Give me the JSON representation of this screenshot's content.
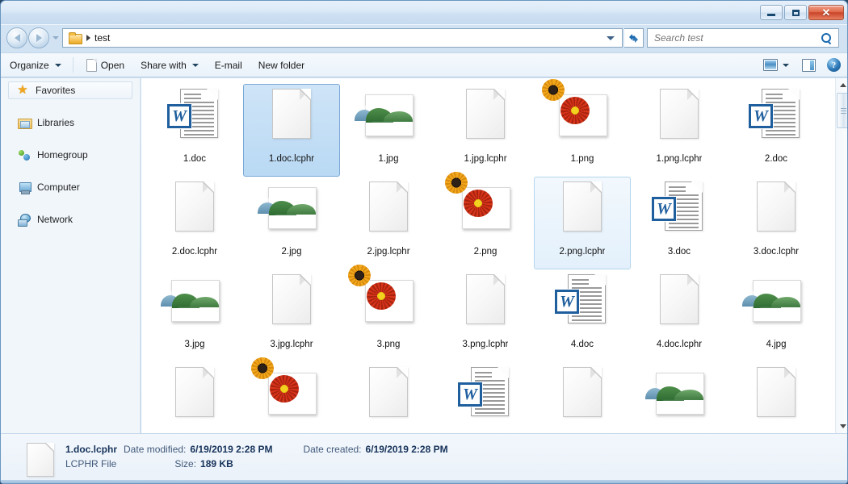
{
  "window": {
    "title": "",
    "buttons": {
      "minimize": "–",
      "maximize": "□",
      "close": "✕"
    }
  },
  "address": {
    "folder_icon": "folder-icon",
    "crumb": "test",
    "dropdown_icon": "chevron-down-icon",
    "refresh_icon": "refresh-icon"
  },
  "search": {
    "placeholder": "Search test",
    "value": "",
    "icon": "search-icon"
  },
  "toolbar": {
    "organize": "Organize",
    "open": "Open",
    "share_with": "Share with",
    "email": "E-mail",
    "new_folder": "New folder",
    "view_icon": "change-view-icon",
    "view_caret_icon": "chevron-down-icon",
    "preview_pane_icon": "preview-pane-icon",
    "help_icon": "help-icon",
    "help_glyph": "?"
  },
  "sidebar": {
    "items": [
      {
        "label": "Favorites",
        "icon": "star-icon",
        "selected": true
      },
      {
        "label": "Libraries",
        "icon": "libraries-icon",
        "selected": false
      },
      {
        "label": "Homegroup",
        "icon": "homegroup-icon",
        "selected": false
      },
      {
        "label": "Computer",
        "icon": "computer-icon",
        "selected": false
      },
      {
        "label": "Network",
        "icon": "network-icon",
        "selected": false
      }
    ]
  },
  "files": [
    {
      "name": "1.doc",
      "kind": "doc",
      "state": "normal"
    },
    {
      "name": "1.doc.lcphr",
      "kind": "blank",
      "state": "selected"
    },
    {
      "name": "1.jpg",
      "kind": "photo-landscape",
      "state": "normal"
    },
    {
      "name": "1.jpg.lcphr",
      "kind": "blank",
      "state": "normal"
    },
    {
      "name": "1.png",
      "kind": "photo-flower",
      "state": "normal"
    },
    {
      "name": "1.png.lcphr",
      "kind": "blank",
      "state": "normal"
    },
    {
      "name": "2.doc",
      "kind": "doc",
      "state": "normal"
    },
    {
      "name": "2.doc.lcphr",
      "kind": "blank",
      "state": "normal"
    },
    {
      "name": "2.jpg",
      "kind": "photo-landscape",
      "state": "normal"
    },
    {
      "name": "2.jpg.lcphr",
      "kind": "blank",
      "state": "normal"
    },
    {
      "name": "2.png",
      "kind": "photo-flower",
      "state": "normal"
    },
    {
      "name": "2.png.lcphr",
      "kind": "blank",
      "state": "hovered"
    },
    {
      "name": "3.doc",
      "kind": "doc",
      "state": "normal"
    },
    {
      "name": "3.doc.lcphr",
      "kind": "blank",
      "state": "normal"
    },
    {
      "name": "3.jpg",
      "kind": "photo-landscape",
      "state": "normal"
    },
    {
      "name": "3.jpg.lcphr",
      "kind": "blank",
      "state": "normal"
    },
    {
      "name": "3.png",
      "kind": "photo-flower",
      "state": "normal"
    },
    {
      "name": "3.png.lcphr",
      "kind": "blank",
      "state": "normal"
    },
    {
      "name": "4.doc",
      "kind": "doc",
      "state": "normal"
    },
    {
      "name": "4.doc.lcphr",
      "kind": "blank",
      "state": "normal"
    },
    {
      "name": "4.jpg",
      "kind": "photo-landscape",
      "state": "normal"
    },
    {
      "name": "",
      "kind": "blank",
      "state": "normal"
    },
    {
      "name": "",
      "kind": "photo-flower",
      "state": "normal"
    },
    {
      "name": "",
      "kind": "blank",
      "state": "normal"
    },
    {
      "name": "",
      "kind": "doc",
      "state": "normal"
    },
    {
      "name": "",
      "kind": "blank",
      "state": "normal"
    },
    {
      "name": "",
      "kind": "photo-landscape",
      "state": "normal"
    },
    {
      "name": "",
      "kind": "blank",
      "state": "normal"
    }
  ],
  "scrollbar": {
    "up_icon": "scroll-up-icon",
    "down_icon": "scroll-down-icon"
  },
  "status": {
    "file_name": "1.doc.lcphr",
    "date_modified_label": "Date modified:",
    "date_modified_value": "6/19/2019 2:28 PM",
    "date_created_label": "Date created:",
    "date_created_value": "6/19/2019 2:28 PM",
    "file_type": "LCPHR File",
    "size_label": "Size:",
    "size_value": "189 KB"
  },
  "colors": {
    "selection": "#b9d9f4",
    "hover": "#e3f0fb",
    "accent": "#1f5f9e",
    "close_button": "#c9442a"
  }
}
